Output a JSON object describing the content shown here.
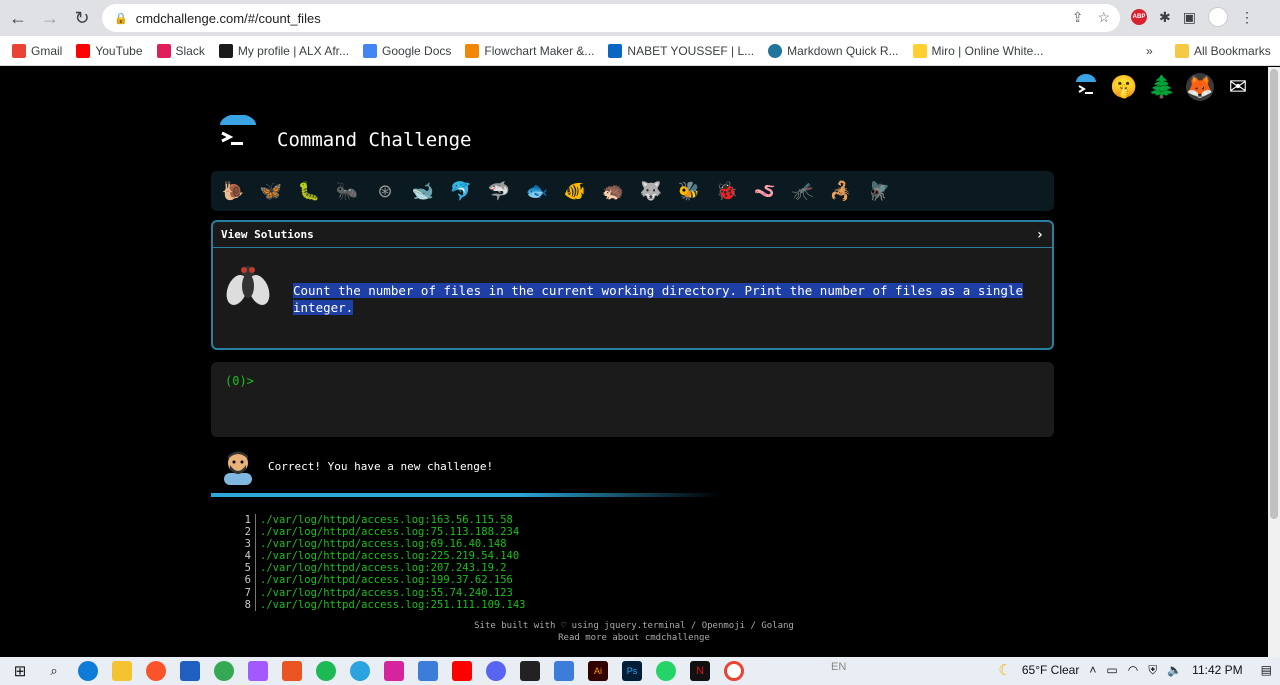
{
  "browser": {
    "url": "cmdchallenge.com/#/count_files",
    "bookmarks": [
      {
        "label": "Gmail",
        "color": "#ea4335"
      },
      {
        "label": "YouTube",
        "color": "#ff0000"
      },
      {
        "label": "Slack",
        "color": "#4a154b"
      },
      {
        "label": "My profile | ALX Afr...",
        "color": "#1a1a1a"
      },
      {
        "label": "Google Docs",
        "color": "#4285f4"
      },
      {
        "label": "Flowchart Maker &...",
        "color": "#f08705"
      },
      {
        "label": "NABET YOUSSEF | L...",
        "color": "#0a66c2"
      },
      {
        "label": "Markdown Quick R...",
        "color": "#21759b"
      },
      {
        "label": "Miro | Online White...",
        "color": "#ffd02f"
      }
    ],
    "all_bookmarks": "All Bookmarks"
  },
  "app": {
    "title": "Command Challenge",
    "view_solutions": "View Solutions",
    "task": "Count the number of files in the current working directory. Print the number of files as a single integer.",
    "prompt": "(0)>",
    "feedback": "Correct! You have a new challenge!"
  },
  "output_lines": [
    "./var/log/httpd/access.log:163.56.115.58",
    "./var/log/httpd/access.log:75.113.188.234",
    "./var/log/httpd/access.log:69.16.40.148",
    "./var/log/httpd/access.log:225.219.54.140",
    "./var/log/httpd/access.log:207.243.19.2",
    "./var/log/httpd/access.log:199.37.62.156",
    "./var/log/httpd/access.log:55.74.240.123",
    "./var/log/httpd/access.log:251.111.109.143"
  ],
  "footer": {
    "line1": "Site built with ♡ using jquery.terminal / Openmoji / Golang",
    "line2": "Read more about cmdchallenge"
  },
  "taskbar": {
    "weather": "65°F  Clear",
    "lang": "EN",
    "time": "11:42 PM"
  }
}
